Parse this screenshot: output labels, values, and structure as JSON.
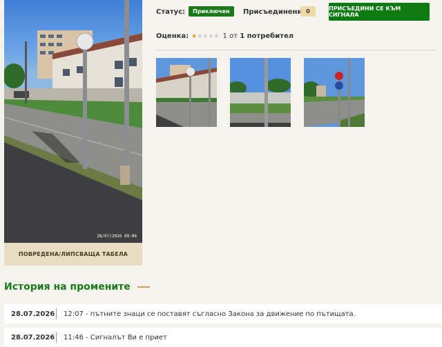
{
  "main_photo": {
    "caption": "ПОВРЕДЕНА/ЛИПСВАЩА ТАБЕЛА",
    "date_stamp": "28/07/2026  09:06"
  },
  "status": {
    "label": "Статус:",
    "value": "Приключен",
    "value_color": "#1a7a1a"
  },
  "joined": {
    "label": "Присъединени:",
    "count": "0"
  },
  "join_button": {
    "label": "ПРИСЪЕДИНИ СЕ КЪМ СИГНАЛА",
    "color": "#0e7a12"
  },
  "rating": {
    "label": "Оценка:",
    "score": 1,
    "max": 5,
    "text_prefix": "1 от",
    "text_users": "1 потребител"
  },
  "thumbnails": [
    {
      "icon": "street-photo-building"
    },
    {
      "icon": "street-photo-fence"
    },
    {
      "icon": "street-photo-road"
    }
  ],
  "history": {
    "title": "История на промените",
    "entries": [
      {
        "date": "28.07.2026",
        "text": "12:07 - пътните знаци се поставят съгласно Закона за движение по пътищата."
      },
      {
        "date": "28.07.2026",
        "text": "11:46 - Сигналът Ви е приет"
      }
    ]
  }
}
